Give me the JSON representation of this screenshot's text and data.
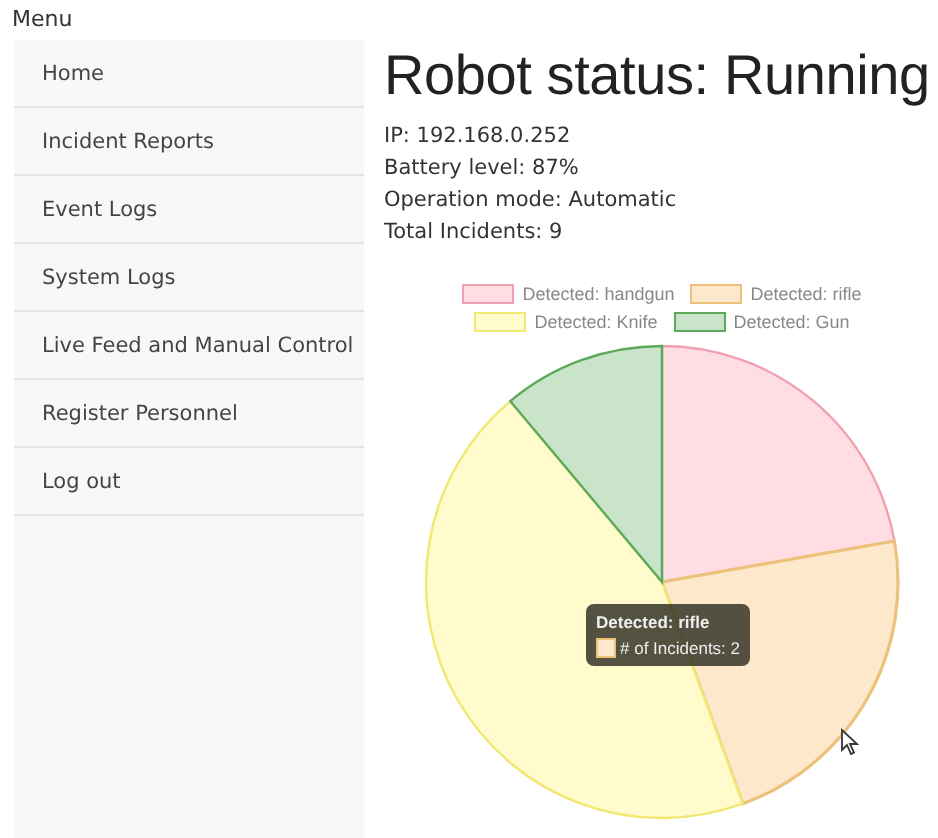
{
  "sidebar": {
    "title": "Menu",
    "items": [
      {
        "label": "Home"
      },
      {
        "label": "Incident Reports"
      },
      {
        "label": "Event Logs"
      },
      {
        "label": "System Logs"
      },
      {
        "label": "Live Feed and Manual Control"
      },
      {
        "label": "Register Personnel"
      },
      {
        "label": "Log out"
      }
    ]
  },
  "main": {
    "title": "Robot status: Running",
    "details": [
      "IP: 192.168.0.252",
      "Battery level: 87%",
      "Operation mode: Automatic",
      "Total Incidents: 9"
    ],
    "chart": {
      "chart_data": {
        "type": "pie",
        "legend": "top",
        "categories": [
          "Detected: handgun",
          "Detected: rifle",
          "Detected: Knife",
          "Detected: Gun"
        ],
        "values": [
          22.22,
          22.22,
          44.45,
          11.11
        ]
      },
      "slices": [
        {
          "color": "#ffdde3",
          "hovered": false
        },
        {
          "color": "#fde8cc",
          "hovered": true
        },
        {
          "color": "#fffbcc",
          "hovered": false
        },
        {
          "color": "#c9e4c8",
          "hovered": false
        }
      ],
      "tooltip": {
        "title": "Detected: rifle",
        "label": "# of Incidents: 2"
      }
    }
  }
}
